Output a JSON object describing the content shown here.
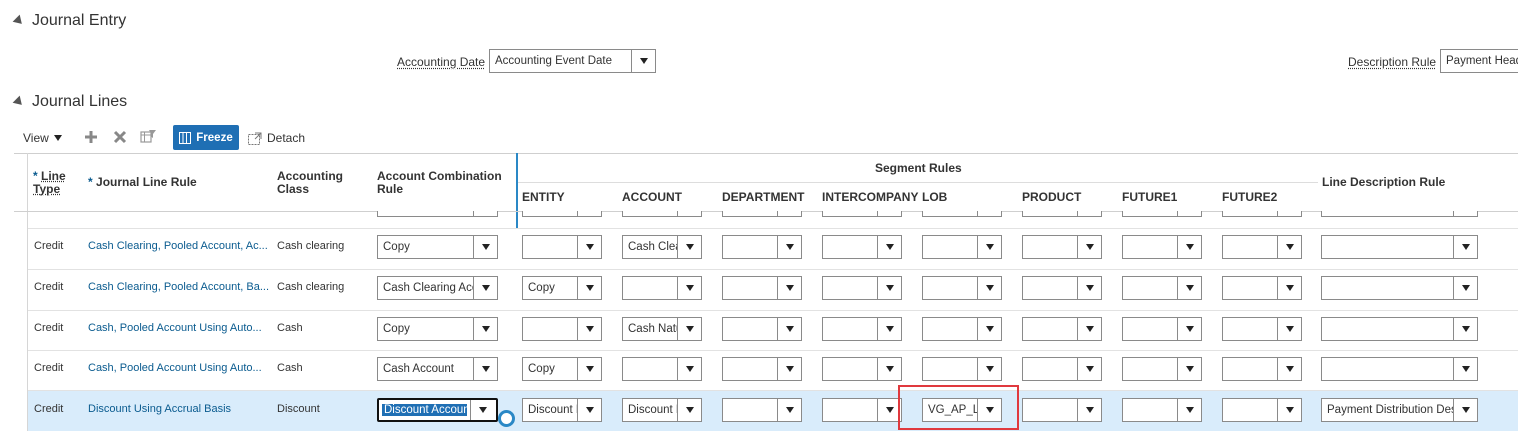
{
  "journal_entry": {
    "title": "Journal Entry",
    "accounting_date_label": "Accounting Date",
    "accounting_date_value": "Accounting Event Date",
    "description_rule_label": "Description Rule",
    "description_rule_value": "Payment Head"
  },
  "journal_lines": {
    "title": "Journal Lines",
    "toolbar": {
      "view_label": "View",
      "freeze_label": "Freeze",
      "detach_label": "Detach"
    },
    "headers": {
      "line_type_req": "*",
      "line_type": "Line",
      "line_type2": "Type",
      "journal_line_rule_req": "*",
      "journal_line_rule": "Journal Line Rule",
      "accounting_class": "Accounting",
      "accounting_class2": "Class",
      "account_combination_rule": "Account Combination",
      "account_combination_rule2": "Rule",
      "segment_rules": "Segment Rules",
      "entity": "ENTITY",
      "account": "ACCOUNT",
      "department": "DEPARTMENT",
      "intercompany": "INTERCOMPANY",
      "lob": "LOB",
      "product": "PRODUCT",
      "future1": "FUTURE1",
      "future2": "FUTURE2",
      "line_description_rule": "Line Description Rule"
    },
    "rows": [
      {
        "line_type": "Credit",
        "journal_line_rule": "Cash Clearing, Pooled Account, Ac...",
        "accounting_class": "Cash clearing",
        "acr": "Copy",
        "entity": "",
        "account": "Cash Clea",
        "department": "",
        "intercompany": "",
        "lob": "",
        "product": "",
        "future1": "",
        "future2": "",
        "ldr": ""
      },
      {
        "line_type": "Credit",
        "journal_line_rule": "Cash Clearing, Pooled Account, Ba...",
        "accounting_class": "Cash clearing",
        "acr": "Cash Clearing Acc",
        "entity": "Copy",
        "account": "",
        "department": "",
        "intercompany": "",
        "lob": "",
        "product": "",
        "future1": "",
        "future2": "",
        "ldr": ""
      },
      {
        "line_type": "Credit",
        "journal_line_rule": "Cash, Pooled Account Using Auto...",
        "accounting_class": "Cash",
        "acr": "Copy",
        "entity": "",
        "account": "Cash Natu",
        "department": "",
        "intercompany": "",
        "lob": "",
        "product": "",
        "future1": "",
        "future2": "",
        "ldr": ""
      },
      {
        "line_type": "Credit",
        "journal_line_rule": "Cash, Pooled Account Using Auto...",
        "accounting_class": "Cash",
        "acr": "Cash Account",
        "entity": "Copy",
        "account": "",
        "department": "",
        "intercompany": "",
        "lob": "",
        "product": "",
        "future1": "",
        "future2": "",
        "ldr": ""
      },
      {
        "line_type": "Credit",
        "journal_line_rule": "Discount Using Accrual Basis",
        "accounting_class": "Discount",
        "acr": "Discount Account",
        "entity": "Discount E",
        "account": "Discount N",
        "department": "",
        "intercompany": "",
        "lob": "VG_AP_LO",
        "product": "",
        "future1": "",
        "future2": "",
        "ldr": "Payment Distribution Desc"
      }
    ]
  },
  "colors": {
    "link": "#0a5b8f",
    "freeze_button": "#1f6fb4",
    "selected_row": "#d9ecfb",
    "highlight_box": "#e0393e",
    "divider": "#2a88c6"
  }
}
